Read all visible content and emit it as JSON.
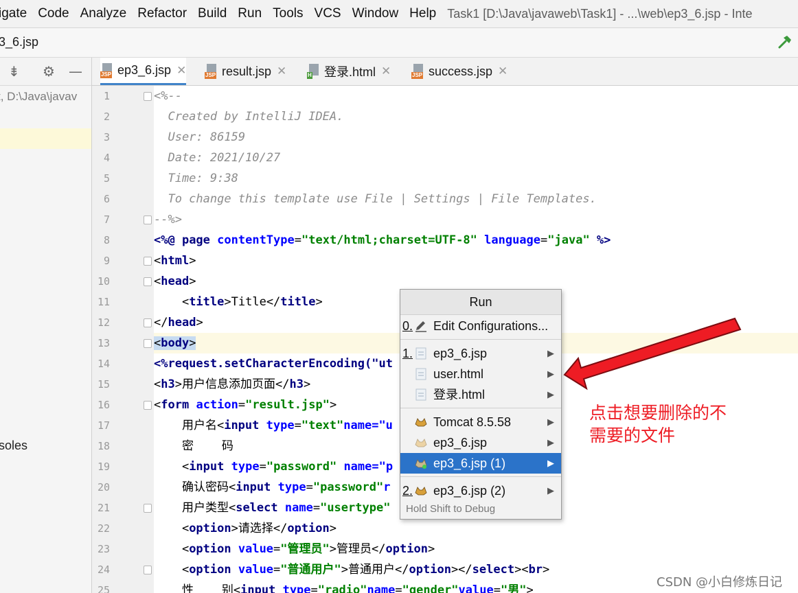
{
  "menu": {
    "items": [
      "igate",
      "Code",
      "Analyze",
      "Refactor",
      "Build",
      "Run",
      "Tools",
      "VCS",
      "Window",
      "Help"
    ],
    "title": "Task1 [D:\\Java\\javaweb\\Task1] - ...\\web\\ep3_6.jsp - Inte"
  },
  "nav": {
    "breadcrumb": "3_6.jsp"
  },
  "project": {
    "path": "t, D:\\Java\\javav",
    "consoles": "soles"
  },
  "tabs": [
    {
      "label": "ep3_6.jsp",
      "type": "JSP",
      "active": true
    },
    {
      "label": "result.jsp",
      "type": "JSP",
      "active": false
    },
    {
      "label": "登录.html",
      "type": "H",
      "active": false
    },
    {
      "label": "success.jsp",
      "type": "JSP",
      "active": false
    }
  ],
  "editor": {
    "line_numbers": [
      "1",
      "2",
      "3",
      "4",
      "5",
      "6",
      "7",
      "8",
      "9",
      "10",
      "11",
      "12",
      "13",
      "14",
      "15",
      "16",
      "17",
      "18",
      "19",
      "20",
      "21",
      "22",
      "23",
      "24",
      "25"
    ],
    "comment": {
      "open": "<%--",
      "created": "  Created by IntelliJ IDEA.",
      "user": "  User: 86159",
      "date": "  Date: 2021/10/27",
      "time": "  Time: 9:38",
      "template": "  To change this template use File | Settings | File Templates.",
      "close": "--%>"
    },
    "directive": {
      "open": "<%@ ",
      "page": "page",
      "ct_attr": "contentType",
      "ct_val": "\"text/html;charset=UTF-8\"",
      "lang_attr": "language",
      "lang_val": "\"java\"",
      "close": " %>"
    },
    "tags": {
      "html": "html",
      "head": "head",
      "title": "title",
      "title_text": "Title",
      "body": "body",
      "h3": "h3",
      "form": "form",
      "input": "input",
      "select": "select",
      "option": "option",
      "br": "br"
    },
    "texts": {
      "setenc": "<%request.setCharacterEncoding(\"ut",
      "h3_text": "用户信息添加页面",
      "form_attr": "action",
      "form_val": "\"result.jsp\"",
      "l17_pre": "    用户名",
      "l17_type": "type",
      "l17_val": "\"text\"",
      "l17_name": "name=\"u",
      "l18": "    密    码",
      "l19_type": "type",
      "l19_val": "\"password\"",
      "l19_name": "name=\"p",
      "l20_pre": "    确认密码",
      "l20_type": "type",
      "l20_val": "\"password\"",
      "l20_name": "r",
      "l21_pre": "    用户类型",
      "l21_name": "name",
      "l21_val": "\"usertype\"",
      "l22_text": "请选择",
      "l23_attr": "value",
      "l23_val": "\"管理员\"",
      "l23_text": "管理员",
      "l24_attr": "value",
      "l24_val": "\"普通用户\"",
      "l24_text": "普通用户",
      "l25_pre": "    性    别",
      "l25_type": "type",
      "l25_tval": "\"radio\"",
      "l25_name": "name",
      "l25_nval": "\"gender\"",
      "l25_value": "value",
      "l25_vval": "\"男\""
    }
  },
  "popup": {
    "header": "Run",
    "items": [
      {
        "num": "0.",
        "label": "Edit Configurations...",
        "icon": "pencil-icon",
        "submenu": false
      },
      {
        "num": "1.",
        "label": "ep3_6.jsp",
        "icon": "html-file-icon",
        "submenu": true
      },
      {
        "num": "",
        "label": "user.html",
        "icon": "html-file-icon",
        "submenu": true
      },
      {
        "num": "",
        "label": "登录.html",
        "icon": "html-file-icon",
        "submenu": true
      },
      {
        "num": "",
        "label": "Tomcat 8.5.58",
        "icon": "tomcat-icon",
        "submenu": true
      },
      {
        "num": "",
        "label": "ep3_6.jsp",
        "icon": "tomcat-faded-icon",
        "submenu": true
      },
      {
        "num": "",
        "label": "ep3_6.jsp (1)",
        "icon": "tomcat-running-icon",
        "submenu": true,
        "selected": true
      },
      {
        "num": "2.",
        "label": "ep3_6.jsp (2)",
        "icon": "tomcat-icon",
        "submenu": true
      }
    ],
    "footer": "Hold Shift to Debug"
  },
  "annotation": {
    "line1": "点击想要删除的不",
    "line2": "需要的文件"
  },
  "watermark": "CSDN @小白修炼日记",
  "colors": {
    "accent": "#2b73c9",
    "annotation_red": "#ee1c24",
    "current_line": "#fdf9e3"
  }
}
